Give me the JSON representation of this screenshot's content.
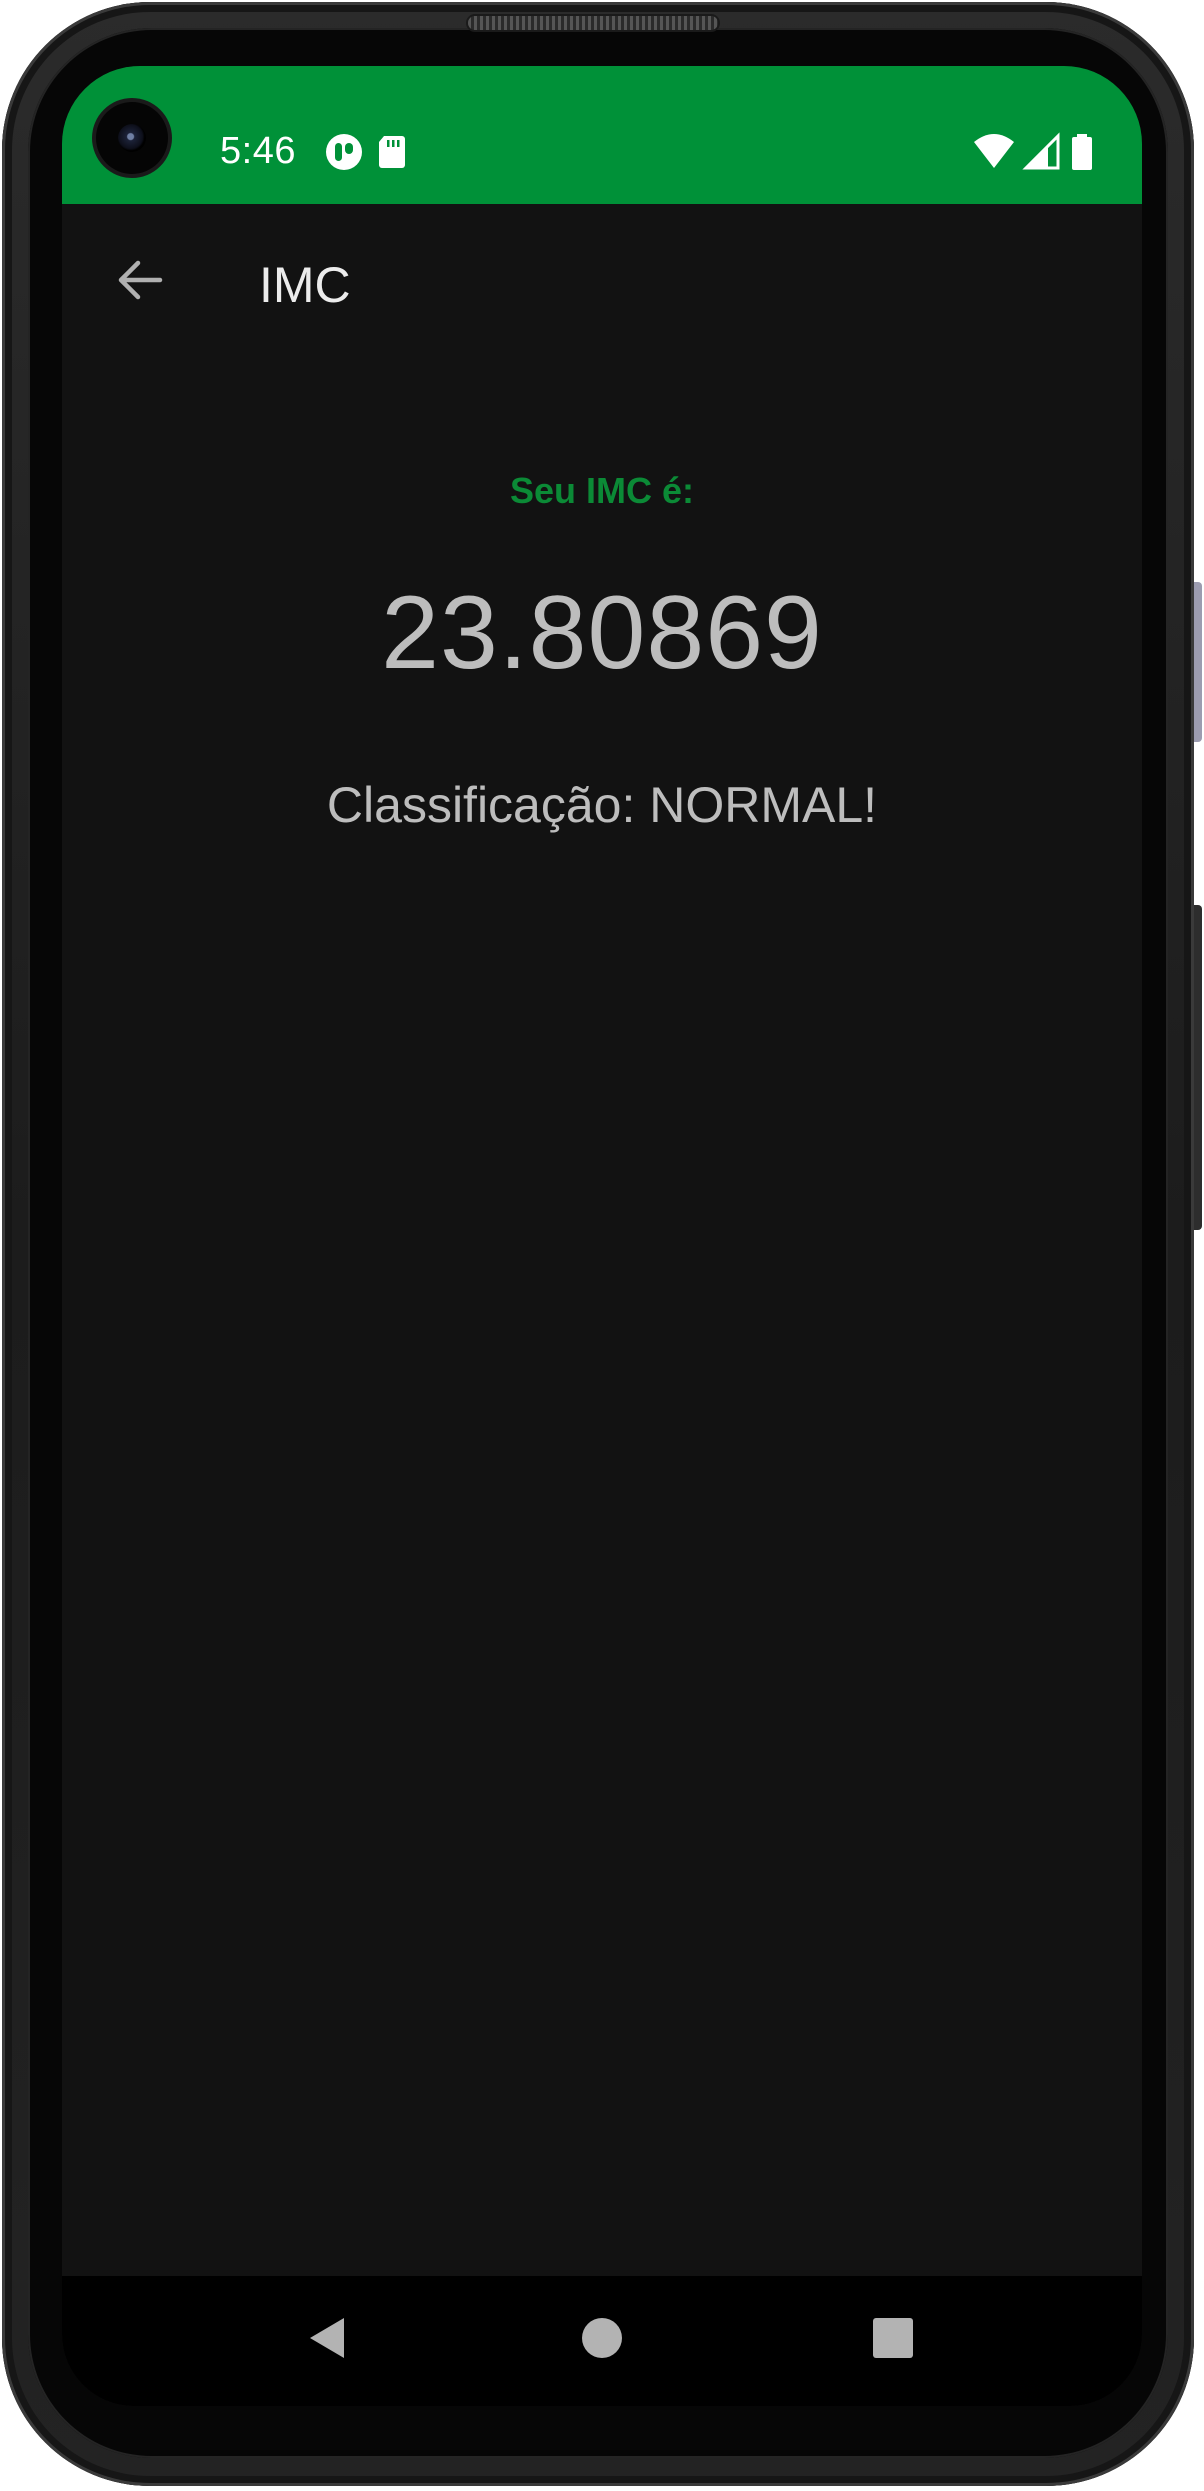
{
  "status_bar": {
    "time": "5:46",
    "background_color": "#009138",
    "icons": [
      "camera-icon",
      "app-notification-icon",
      "sd-card-icon",
      "wifi-icon",
      "cellular-signal-icon",
      "battery-icon"
    ]
  },
  "app_bar": {
    "title": "IMC",
    "back_icon": "arrow-back-icon"
  },
  "result": {
    "label": "Seu IMC é:",
    "value": "23.80869",
    "classification": "Classificação: NORMAL!",
    "label_color": "#0b8a36"
  },
  "nav_bar": {
    "buttons": [
      "back-triangle-icon",
      "home-circle-icon",
      "recents-square-icon"
    ]
  }
}
